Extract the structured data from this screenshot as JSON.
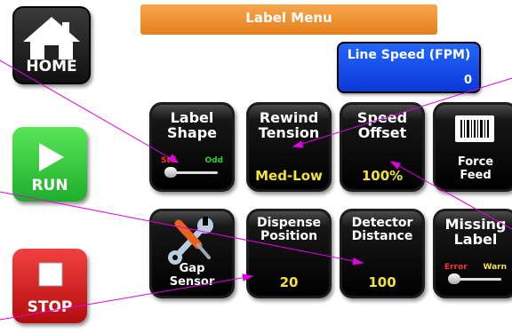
{
  "side": {
    "home_label": "HOME",
    "run_label": "RUN",
    "stop_label": "STOP"
  },
  "header": {
    "title": "Label Menu"
  },
  "line_speed": {
    "label": "Line Speed (FPM)",
    "value": "0"
  },
  "tiles": [
    {
      "title": "Label Shape",
      "left_option": "Std",
      "right_option": "Odd",
      "slider_position": 0
    },
    {
      "title": "Rewind Tension",
      "value": "Med-Low"
    },
    {
      "title": "Speed Offset",
      "value": "100%"
    },
    {
      "title": "Force Feed",
      "icon": "barcode-label-icon"
    },
    {
      "title": "Gap Sensor",
      "icon": "wrench-screwdriver-icon"
    },
    {
      "title": "Dispense Position",
      "value": "20"
    },
    {
      "title": "Detector Distance",
      "value": "100"
    },
    {
      "title": "Missing Label",
      "left_option": "Error",
      "right_option": "Warn",
      "slider_position": 0
    }
  ],
  "colors": {
    "header": "#ef8f2c",
    "line_speed": "#1450f0",
    "run": "#2cc43a",
    "stop": "#d91f1f",
    "value_text": "#f2e33c",
    "callout_line": "#e100e1"
  }
}
